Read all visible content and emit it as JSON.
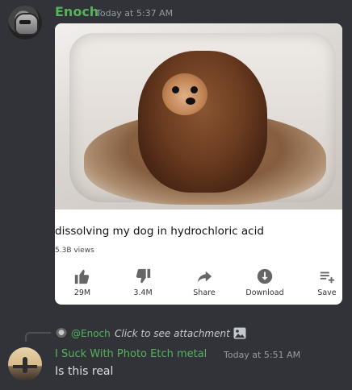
{
  "message1": {
    "author": "Enoch",
    "timestamp": "Today at 5:37 AM",
    "attachment": {
      "caption": "dissolving my dog in hydrochloric acid",
      "views": "5.3B views",
      "actions": [
        {
          "icon": "thumbs-up-icon",
          "label": "29M"
        },
        {
          "icon": "thumbs-down-icon",
          "label": "3.4M"
        },
        {
          "icon": "share-icon",
          "label": "Share"
        },
        {
          "icon": "download-icon",
          "label": "Download"
        },
        {
          "icon": "save-icon",
          "label": "Save"
        }
      ]
    }
  },
  "message2": {
    "reply": {
      "mention": "@Enoch",
      "text": "Click to see attachment"
    },
    "author": "I Suck With Photo Etch metal",
    "timestamp": "Today at 5:51 AM",
    "content": "Is this real"
  },
  "colors": {
    "background": "#313338",
    "username": "#57b15d",
    "timestamp": "#949ba4",
    "text": "#dbdee1"
  }
}
